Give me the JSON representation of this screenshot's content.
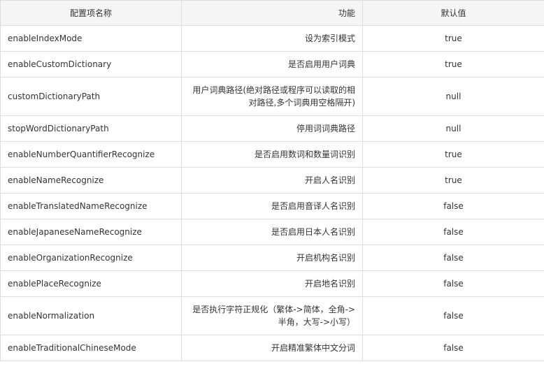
{
  "table": {
    "headers": {
      "name": "配置项名称",
      "function": "功能",
      "default": "默认值"
    },
    "rows": [
      {
        "name": "enableIndexMode",
        "function": "设为索引模式",
        "default": "true"
      },
      {
        "name": "enableCustomDictionary",
        "function": "是否启用用户词典",
        "default": "true"
      },
      {
        "name": "customDictionaryPath",
        "function": "用户词典路径(绝对路径或程序可以读取的相对路径,多个词典用空格隔开)",
        "default": "null"
      },
      {
        "name": "stopWordDictionaryPath",
        "function": "停用词词典路径",
        "default": "null"
      },
      {
        "name": "enableNumberQuantifierRecognize",
        "function": "是否启用数词和数量词识别",
        "default": "true"
      },
      {
        "name": "enableNameRecognize",
        "function": "开启人名识别",
        "default": "true"
      },
      {
        "name": "enableTranslatedNameRecognize",
        "function": "是否启用音译人名识别",
        "default": "false"
      },
      {
        "name": "enableJapaneseNameRecognize",
        "function": "是否启用日本人名识别",
        "default": "false"
      },
      {
        "name": "enableOrganizationRecognize",
        "function": "开启机构名识别",
        "default": "false"
      },
      {
        "name": "enablePlaceRecognize",
        "function": "开启地名识别",
        "default": "false"
      },
      {
        "name": "enableNormalization",
        "function": "是否执行字符正规化（繁体->简体，全角->半角，大写->小写）",
        "default": "false"
      },
      {
        "name": "enableTraditionalChineseMode",
        "function": "开启精准繁体中文分词",
        "default": "false"
      }
    ]
  }
}
